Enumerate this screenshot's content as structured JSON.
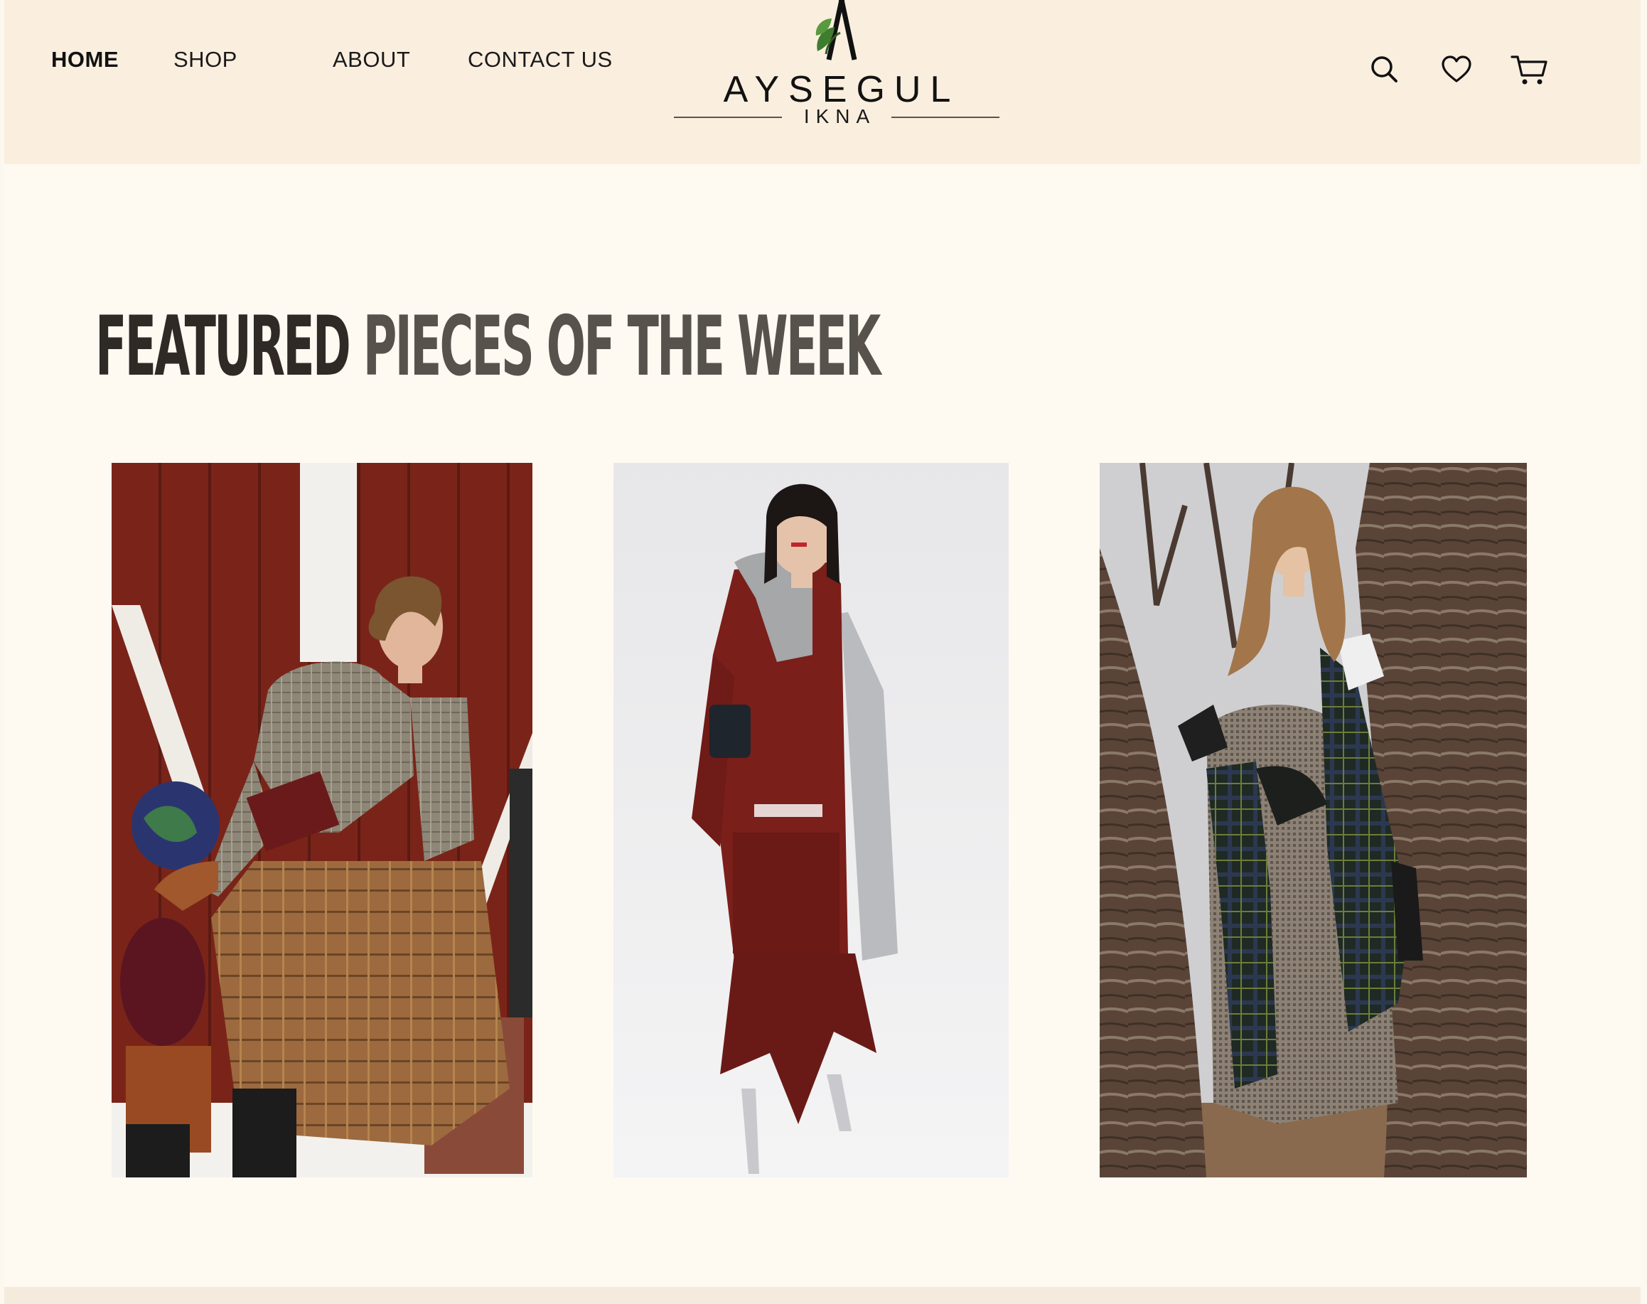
{
  "nav": {
    "items": [
      {
        "label": "HOME",
        "active": true
      },
      {
        "label": "SHOP"
      },
      {
        "label": "ABOUT"
      },
      {
        "label": "CONTACT US"
      }
    ]
  },
  "brand": {
    "name": "AYSEGUL",
    "sub": "IKNA",
    "logo_leaf_color": "#3e7d2e"
  },
  "header_icons": [
    "search-icon",
    "heart-icon",
    "cart-icon"
  ],
  "featured": {
    "title_part1": "FEATURED",
    "title_part2": "PIECES OF THE WEEK"
  },
  "colors": {
    "header_bg": "#faefdf",
    "page_bg": "#fefaf2",
    "title_dark": "#2f2a26",
    "title_gray": "#58524c"
  }
}
